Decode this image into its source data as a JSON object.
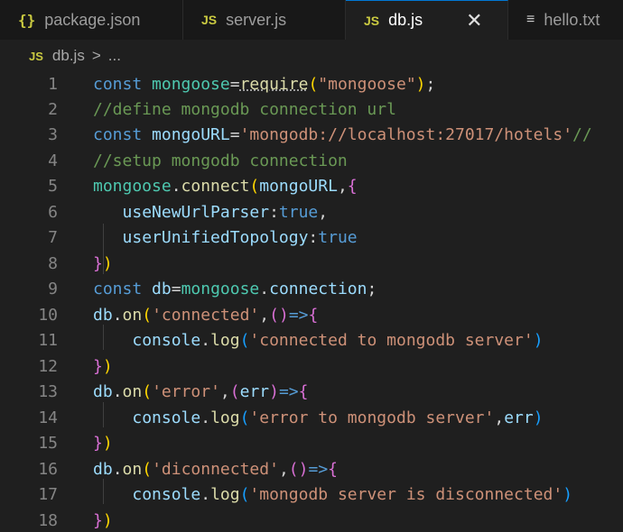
{
  "tabs": [
    {
      "label": "package.json",
      "icon": "{}"
    },
    {
      "label": "server.js",
      "icon": "JS"
    },
    {
      "label": "db.js",
      "icon": "JS",
      "close": "✕"
    },
    {
      "label": "hello.txt",
      "icon": "≡"
    }
  ],
  "breadcrumb": {
    "icon": "JS",
    "file": "db.js",
    "sep": ">",
    "more": "..."
  },
  "lines": [
    {
      "n": "1",
      "t": [
        [
          "k",
          "const "
        ],
        [
          "v",
          "mongoose"
        ],
        [
          "p",
          "="
        ],
        [
          "f",
          "require"
        ],
        [
          "b1",
          "("
        ],
        [
          "s",
          "\"mongoose\""
        ],
        [
          "b1",
          ")"
        ],
        [
          "p",
          ";"
        ]
      ]
    },
    {
      "n": "2",
      "t": [
        [
          "c",
          "//define mongodb connection url"
        ]
      ]
    },
    {
      "n": "3",
      "t": [
        [
          "k",
          "const "
        ],
        [
          "v2",
          "mongoURL"
        ],
        [
          "p",
          "="
        ],
        [
          "s",
          "'mongodb://localhost:27017/hotels'"
        ],
        [
          "c",
          "//"
        ]
      ]
    },
    {
      "n": "4",
      "t": [
        [
          "c",
          "//setup mongodb connection"
        ]
      ]
    },
    {
      "n": "5",
      "t": [
        [
          "v",
          "mongoose"
        ],
        [
          "p",
          "."
        ],
        [
          "f",
          "connect"
        ],
        [
          "b1",
          "("
        ],
        [
          "v2",
          "mongoURL"
        ],
        [
          "p",
          ","
        ],
        [
          "b2",
          "{"
        ]
      ]
    },
    {
      "n": "6",
      "t": [
        [
          "p",
          "   "
        ],
        [
          "v2",
          "useNewUrlParser"
        ],
        [
          "p",
          ":"
        ],
        [
          "k",
          "true"
        ],
        [
          "p",
          ","
        ]
      ]
    },
    {
      "n": "7",
      "t": [
        [
          "p",
          "   "
        ],
        [
          "v2",
          "userUnifiedTopology"
        ],
        [
          "p",
          ":"
        ],
        [
          "k",
          "true"
        ]
      ]
    },
    {
      "n": "8",
      "t": [
        [
          "b2",
          "}"
        ],
        [
          "b1",
          ")"
        ]
      ]
    },
    {
      "n": "9",
      "t": [
        [
          "k",
          "const "
        ],
        [
          "v2",
          "db"
        ],
        [
          "p",
          "="
        ],
        [
          "v",
          "mongoose"
        ],
        [
          "p",
          "."
        ],
        [
          "v2",
          "connection"
        ],
        [
          "p",
          ";"
        ]
      ]
    },
    {
      "n": "10",
      "t": [
        [
          "v2",
          "db"
        ],
        [
          "p",
          "."
        ],
        [
          "f",
          "on"
        ],
        [
          "b1",
          "("
        ],
        [
          "s",
          "'connected'"
        ],
        [
          "p",
          ","
        ],
        [
          "b2",
          "()"
        ],
        [
          "k",
          "=>"
        ],
        [
          "b2",
          "{"
        ]
      ]
    },
    {
      "n": "11",
      "t": [
        [
          "p",
          "    "
        ],
        [
          "v2",
          "console"
        ],
        [
          "p",
          "."
        ],
        [
          "f",
          "log"
        ],
        [
          "b3",
          "("
        ],
        [
          "s",
          "'connected to mongodb server'"
        ],
        [
          "b3",
          ")"
        ]
      ]
    },
    {
      "n": "12",
      "t": [
        [
          "b2",
          "}"
        ],
        [
          "b1",
          ")"
        ]
      ]
    },
    {
      "n": "13",
      "t": [
        [
          "v2",
          "db"
        ],
        [
          "p",
          "."
        ],
        [
          "f",
          "on"
        ],
        [
          "b1",
          "("
        ],
        [
          "s",
          "'error'"
        ],
        [
          "p",
          ","
        ],
        [
          "b2",
          "("
        ],
        [
          "v2",
          "err"
        ],
        [
          "b2",
          ")"
        ],
        [
          "k",
          "=>"
        ],
        [
          "b2",
          "{"
        ]
      ]
    },
    {
      "n": "14",
      "t": [
        [
          "p",
          "    "
        ],
        [
          "v2",
          "console"
        ],
        [
          "p",
          "."
        ],
        [
          "f",
          "log"
        ],
        [
          "b3",
          "("
        ],
        [
          "s",
          "'error to mongodb server'"
        ],
        [
          "p",
          ","
        ],
        [
          "v2",
          "err"
        ],
        [
          "b3",
          ")"
        ]
      ]
    },
    {
      "n": "15",
      "t": [
        [
          "b2",
          "}"
        ],
        [
          "b1",
          ")"
        ]
      ]
    },
    {
      "n": "16",
      "t": [
        [
          "v2",
          "db"
        ],
        [
          "p",
          "."
        ],
        [
          "f",
          "on"
        ],
        [
          "b1",
          "("
        ],
        [
          "s",
          "'diconnected'"
        ],
        [
          "p",
          ","
        ],
        [
          "b2",
          "()"
        ],
        [
          "k",
          "=>"
        ],
        [
          "b2",
          "{"
        ]
      ]
    },
    {
      "n": "17",
      "t": [
        [
          "p",
          "    "
        ],
        [
          "v2",
          "console"
        ],
        [
          "p",
          "."
        ],
        [
          "f",
          "log"
        ],
        [
          "b3",
          "("
        ],
        [
          "s",
          "'mongodb server is disconnected'"
        ],
        [
          "b3",
          ")"
        ]
      ]
    },
    {
      "n": "18",
      "t": [
        [
          "b2",
          "}"
        ],
        [
          "b1",
          ")"
        ]
      ]
    }
  ]
}
